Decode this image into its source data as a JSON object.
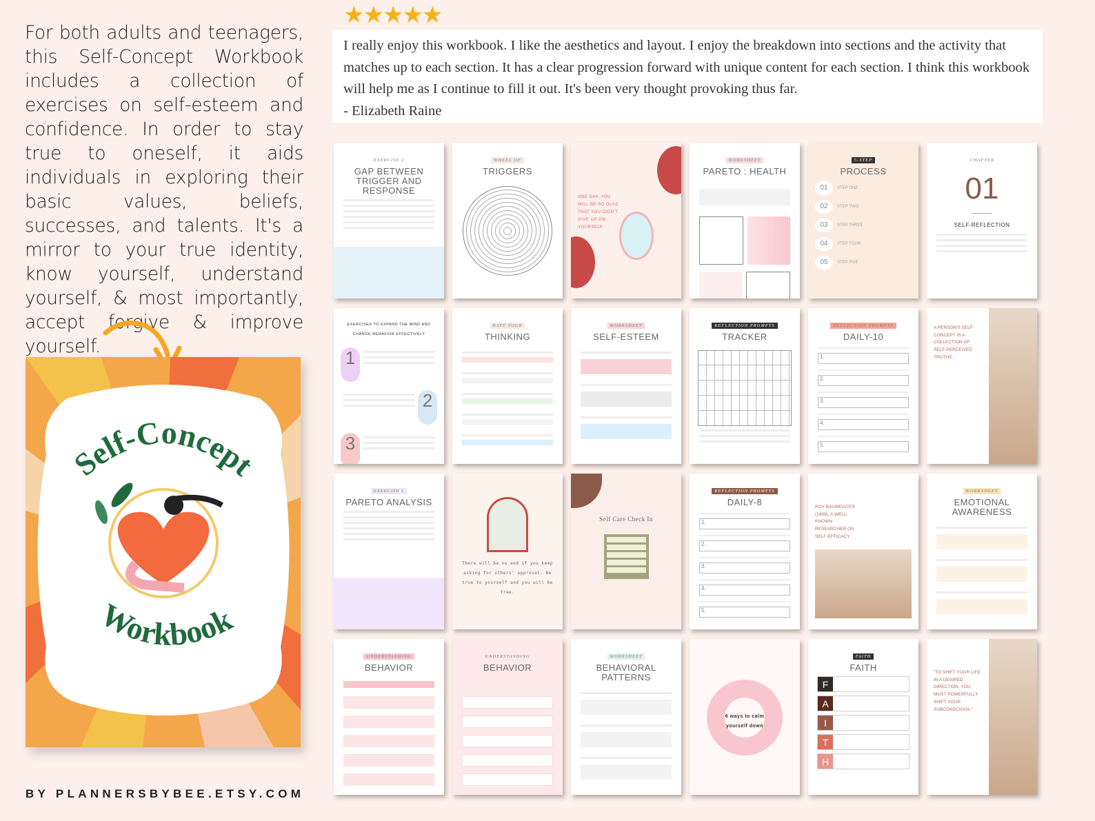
{
  "intro": "For both adults and teenagers, this Self-Concept Workbook includes a collection of exercises on self-esteem and confidence. In order to stay true to oneself, it aids individuals in exploring their basic values, beliefs, successes, and talents. It's a mirror to your true identity, know yourself, understand yourself, & most importantly, accept forgive & improve yourself.",
  "cover": {
    "title_top": "Self-Concept",
    "title_bottom": "Workbook"
  },
  "footer": "BY PLANNERSBYBEE.ETSY.COM",
  "rating": {
    "stars": 5,
    "glyphs": "★★★★★"
  },
  "review": {
    "text": "I really enjoy this workbook. I like the aesthetics and layout. I enjoy the breakdown into sections and the activity that matches up to each section. It has a clear progression forward with unique content for each section. I think this workbook will help me as I continue to fill it out. It's been very thought provoking thus far.",
    "author": "- Elizabeth Raine"
  },
  "colors": {
    "background": "#fdf0ea",
    "star": "#f7b21a",
    "cover_green": "#1f6b3c",
    "heart": "#f26a3d"
  },
  "pages": [
    {
      "label": "Exercise 2",
      "title": "GAP BETWEEN TRIGGER AND RESPONSE",
      "label_bg": "#fff",
      "kind": "text"
    },
    {
      "label": "Wheel of",
      "title": "TRIGGERS",
      "label_bg": "#f6e7e2",
      "kind": "wheel"
    },
    {
      "label": "",
      "title": "ONE DAY, YOU WILL BE SO GLAD THAT YOU DIDN'T GIVE UP ON YOURSELF.",
      "label_bg": "#fff",
      "kind": "quote"
    },
    {
      "label": "Worksheet",
      "title": "PARETO : HEALTH",
      "label_bg": "#f9dcdc",
      "kind": "boxes"
    },
    {
      "label": "5-step",
      "title": "PROCESS",
      "label_bg": "#333",
      "kind": "steps",
      "steps": [
        "01",
        "02",
        "03",
        "04",
        "05"
      ],
      "step_names": [
        "STEP ONE",
        "STEP TWO",
        "STEP THREE",
        "STEP FOUR",
        "STEP FIVE"
      ]
    },
    {
      "label": "Chapter",
      "title": "SELF-REFLECTION",
      "number": "01",
      "label_bg": "#fff",
      "kind": "chapter"
    },
    {
      "label": "",
      "title": "EXERCISES TO EXPAND THE MIND AND CHANGE BEHAVIOR EFFECTIVELY",
      "label_bg": "#fff",
      "kind": "numbers",
      "items": [
        "1",
        "2",
        "3"
      ]
    },
    {
      "label": "Rate your",
      "title": "THINKING",
      "label_bg": "#f6e7e2",
      "kind": "rating"
    },
    {
      "label": "Worksheet",
      "title": "SELF-ESTEEM",
      "label_bg": "#f9d3d8",
      "kind": "blocks"
    },
    {
      "label": "Reflection prompts",
      "title": "TRACKER",
      "label_bg": "#333",
      "kind": "table"
    },
    {
      "label": "Reflection prompts",
      "title": "DAILY-10",
      "label_bg": "#f2a58e",
      "kind": "list"
    },
    {
      "label": "",
      "title": "A PERSON'S SELF-CONCEPT IS A COLLECTION OF SELF-PERCEIVED TRUTHS.",
      "label_bg": "#fff",
      "kind": "photo"
    },
    {
      "label": "Exercise 1",
      "title": "PARETO ANALYSIS",
      "label_bg": "#eee6f5",
      "kind": "text"
    },
    {
      "label": "",
      "title": "There will be no end if you keep asking for others' approval. Be true to yourself and you will be free.",
      "label_bg": "#fff",
      "kind": "quote2"
    },
    {
      "label": "",
      "title": "Self Care Check In",
      "label_bg": "#fff",
      "kind": "checkin"
    },
    {
      "label": "Reflection prompts",
      "title": "DAILY-8",
      "label_bg": "#8c5a4a",
      "kind": "list"
    },
    {
      "label": "",
      "title": "Roy Baumeister (1999), a well-known researcher on self-efficacy",
      "label_bg": "#fff",
      "kind": "photo2"
    },
    {
      "label": "Worksheet",
      "title": "EMOTIONAL AWARENESS",
      "label_bg": "#fbe1b5",
      "kind": "blocks"
    },
    {
      "label": "Understanding",
      "title": "BEHAVIOR",
      "label_bg": "#f9c6cc",
      "kind": "flow"
    },
    {
      "label": "Understanding",
      "title": "BEHAVIOR",
      "label_bg": "#fde9ea",
      "kind": "flow"
    },
    {
      "label": "Worksheet",
      "title": "BEHAVIORAL PATTERNS",
      "label_bg": "#dff0e6",
      "kind": "blocks"
    },
    {
      "label": "",
      "title": "6 ways to calm yourself down",
      "label_bg": "#fff",
      "kind": "circle"
    },
    {
      "label": "Faith",
      "title": "FAITH",
      "label_bg": "#333",
      "kind": "faith",
      "letters": [
        "F",
        "A",
        "I",
        "T",
        "H"
      ]
    },
    {
      "label": "",
      "title": "\"TO SHIFT YOUR LIFE IN A DESIRED DIRECTION, YOU MUST POWERFULLY SHIFT YOUR SUBCONSCIOUS.\"",
      "label_bg": "#fff",
      "kind": "photo3"
    }
  ]
}
